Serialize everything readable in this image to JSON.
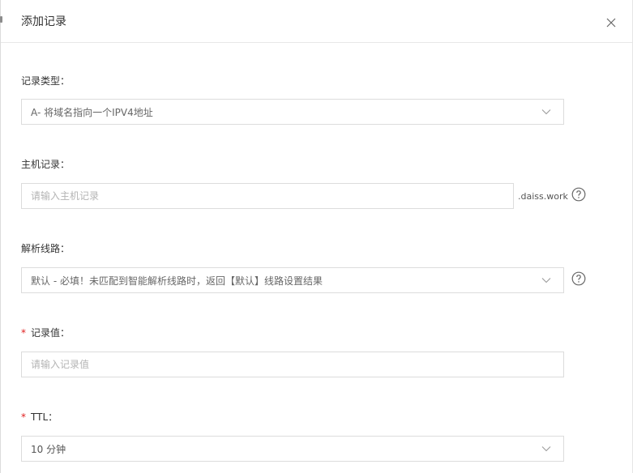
{
  "dialog": {
    "title": "添加记录"
  },
  "record_type": {
    "label": "记录类型：",
    "value": "A- 将域名指向一个IPV4地址"
  },
  "host": {
    "label": "主机记录：",
    "placeholder": "请输入主机记录",
    "suffix": ".daiss.work"
  },
  "line": {
    "label": "解析线路：",
    "value": "默认 - 必填！未匹配到智能解析线路时，返回【默认】线路设置结果"
  },
  "record_value": {
    "required_mark": "*",
    "label": "记录值：",
    "placeholder": "请输入记录值"
  },
  "ttl": {
    "required_mark": "*",
    "label": "TTL：",
    "value": "10 分钟"
  },
  "colors": {
    "border": "#dcdcdc",
    "required": "#e02020",
    "placeholder": "#b4b4b4"
  },
  "icons": [
    "close-icon",
    "chevron-down-icon",
    "help-icon"
  ]
}
